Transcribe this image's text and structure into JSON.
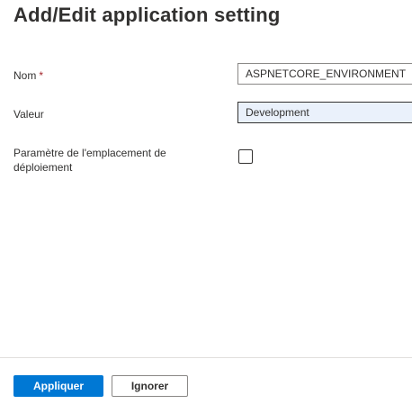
{
  "panel": {
    "title": "Add/Edit application setting"
  },
  "form": {
    "name": {
      "label": "Nom",
      "required_marker": "*",
      "value": "ASPNETCORE_ENVIRONMENT"
    },
    "value": {
      "label": "Valeur",
      "value": "Development"
    },
    "slot_setting": {
      "label": "Paramètre de l'emplacement de déploiement",
      "checked": false
    }
  },
  "footer": {
    "apply_label": "Appliquer",
    "ignore_label": "Ignorer"
  },
  "colors": {
    "primary": "#0078d4",
    "required": "#a4262c",
    "text": "#323130",
    "selected_input_bg": "#eaf1fb"
  }
}
